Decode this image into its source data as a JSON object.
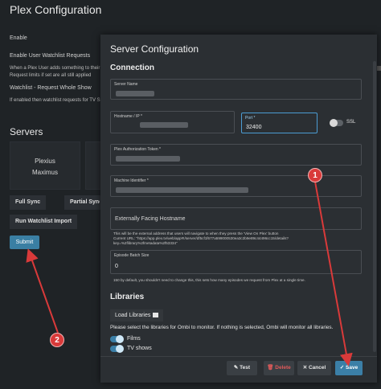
{
  "background": {
    "title": "Plex Configuration",
    "enable_label": "Enable",
    "watchlist_label": "Enable User Watchlist Requests",
    "watchlist_help_1": "When a Plex User adds something to their",
    "watchlist_help_2": "Request limits if set are all still applied",
    "whole_show_label": "Watchlist - Request Whole Show",
    "whole_show_help": "If enabled then watchlist requests for TV S",
    "servers_heading": "Servers",
    "server_card": [
      "Plexius",
      "Maximus"
    ],
    "buttons": {
      "full_sync": "Full Sync",
      "partial_sync": "Partial Sync",
      "run_watchlist_import": "Run Watchlist Import",
      "submit": "Submit"
    }
  },
  "modal": {
    "title": "Server Configuration",
    "connection_heading": "Connection",
    "server_name_label": "Server Name",
    "hostname_label": "Hostname / IP *",
    "port_label": "Port *",
    "port_value": "32400",
    "ssl_label": "SSL",
    "auth_token_label": "Plex Authorization Token *",
    "machine_id_label": "Machine Identifier *",
    "hostname_placeholder": "Externally Facing Hostname",
    "hostname_help_1": "This will be the external address that users will navigate to when they press the 'View On Plex' button",
    "hostname_help_2": "Current URL: \"https://app.plex.tv/web/app#!/server/df5cf1f677a599000530ea3c2b9e89c44496cc15/details?",
    "hostname_help_3": "key=%2flibrary%2fmetadata%2f53334\"",
    "batch_size_label": "Episode Batch Size",
    "batch_size_value": "0",
    "batch_size_help": "150 by default, you shouldn't need to change this, this sets how many episodes we request from Plex at a single time.",
    "libraries_heading": "Libraries",
    "load_libraries_label": "Load Libraries",
    "libraries_info": "Please select the libraries for Ombi to monitor. If nothing is selected, Ombi will monitor all libraries.",
    "libraries": [
      {
        "label": "Films",
        "enabled": true
      },
      {
        "label": "TV shows",
        "enabled": true
      }
    ],
    "footer": {
      "test": "✎ Test",
      "delete": "🗑 Delete",
      "cancel": "✕ Cancel",
      "save": "✓ Save"
    }
  },
  "annotations": {
    "badge_1": "1",
    "badge_2": "2",
    "color": "#d93a3a"
  },
  "colors": {
    "accent": "#3b7fa7",
    "delete": "#e05a5a",
    "focus": "#4b9cd3"
  }
}
